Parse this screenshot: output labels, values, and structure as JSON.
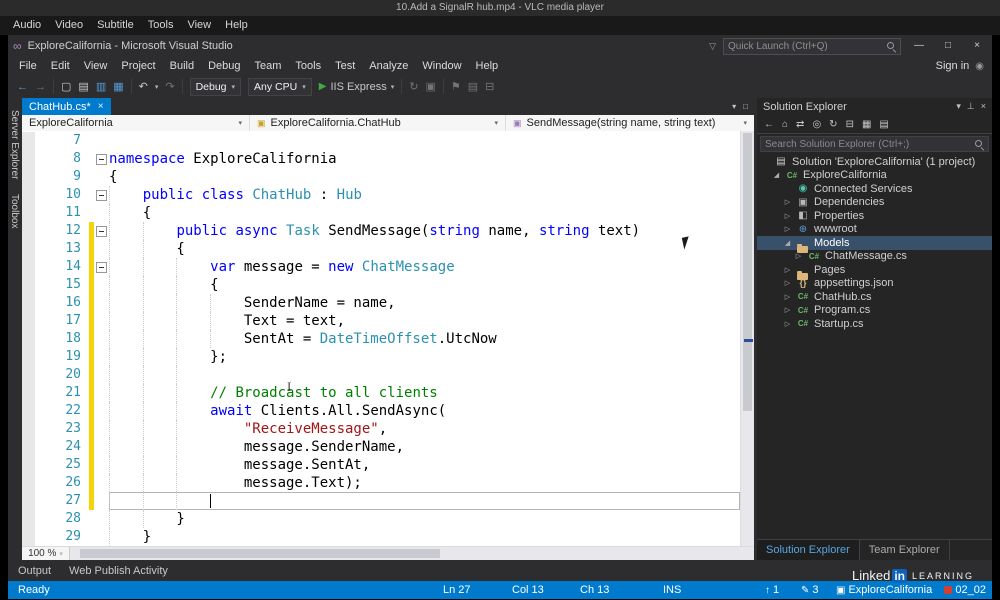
{
  "vlc": {
    "title": "10.Add a SignalR hub.mp4 - VLC media player",
    "menu": [
      "Audio",
      "Video",
      "Subtitle",
      "Tools",
      "View",
      "Help"
    ]
  },
  "vs": {
    "title": "ExploreCalifornia - Microsoft Visual Studio",
    "quick_launch_placeholder": "Quick Launch (Ctrl+Q)",
    "menu": [
      "File",
      "Edit",
      "View",
      "Project",
      "Build",
      "Debug",
      "Team",
      "Tools",
      "Test",
      "Analyze",
      "Window",
      "Help"
    ],
    "sign_in": "Sign in",
    "toolbar": {
      "debug_target": "Debug",
      "platform": "Any CPU",
      "run_label": "IIS Express"
    },
    "side_tabs": [
      "Server Explorer",
      "Toolbox"
    ],
    "doc_tab": {
      "label": "ChatHub.cs*"
    },
    "navbar": [
      "ExploreCalifornia",
      "ExploreCalifornia.ChatHub",
      "SendMessage(string name, string text)"
    ],
    "zoom": "100 %",
    "panel_tabs": [
      "Output",
      "Web Publish Activity"
    ],
    "status": {
      "ready": "Ready",
      "ln": "Ln 27",
      "col": "Col 13",
      "ch": "Ch 13",
      "ins": "INS",
      "push": "1",
      "edits": "3",
      "repo": "ExploreCalifornia",
      "chapter": "02_02"
    }
  },
  "editor": {
    "lines": [
      {
        "n": 7,
        "tokens": [],
        "guides": []
      },
      {
        "n": 8,
        "fold": true,
        "tokens": [
          [
            "k",
            "namespace"
          ],
          [
            "p",
            " ExploreCalifornia"
          ]
        ],
        "guides": []
      },
      {
        "n": 9,
        "tokens": [
          [
            "p",
            "{"
          ]
        ],
        "guides": []
      },
      {
        "n": 10,
        "fold": true,
        "tokens": [
          [
            "p",
            "    "
          ],
          [
            "k",
            "public"
          ],
          [
            "p",
            " "
          ],
          [
            "k",
            "class"
          ],
          [
            "p",
            " "
          ],
          [
            "t",
            "ChatHub"
          ],
          [
            "p",
            " : "
          ],
          [
            "t",
            "Hub"
          ]
        ],
        "guides": [
          0
        ]
      },
      {
        "n": 11,
        "tokens": [
          [
            "p",
            "    {"
          ]
        ],
        "guides": [
          0
        ]
      },
      {
        "n": 12,
        "fold": true,
        "changed": true,
        "tokens": [
          [
            "p",
            "        "
          ],
          [
            "k",
            "public"
          ],
          [
            "p",
            " "
          ],
          [
            "k",
            "async"
          ],
          [
            "p",
            " "
          ],
          [
            "t",
            "Task"
          ],
          [
            "p",
            " SendMessage("
          ],
          [
            "k",
            "string"
          ],
          [
            "p",
            " name, "
          ],
          [
            "k",
            "string"
          ],
          [
            "p",
            " text)"
          ]
        ],
        "guides": [
          0,
          4
        ]
      },
      {
        "n": 13,
        "changed": true,
        "tokens": [
          [
            "p",
            "        {"
          ]
        ],
        "guides": [
          0,
          4
        ]
      },
      {
        "n": 14,
        "fold": true,
        "changed": true,
        "tokens": [
          [
            "p",
            "            "
          ],
          [
            "k",
            "var"
          ],
          [
            "p",
            " message = "
          ],
          [
            "k",
            "new"
          ],
          [
            "p",
            " "
          ],
          [
            "t",
            "ChatMessage"
          ]
        ],
        "guides": [
          0,
          4,
          8
        ]
      },
      {
        "n": 15,
        "changed": true,
        "tokens": [
          [
            "p",
            "            {"
          ]
        ],
        "guides": [
          0,
          4,
          8
        ]
      },
      {
        "n": 16,
        "changed": true,
        "tokens": [
          [
            "p",
            "                SenderName = name,"
          ]
        ],
        "guides": [
          0,
          4,
          8,
          12
        ]
      },
      {
        "n": 17,
        "changed": true,
        "tokens": [
          [
            "p",
            "                Text = text,"
          ]
        ],
        "guides": [
          0,
          4,
          8,
          12
        ]
      },
      {
        "n": 18,
        "changed": true,
        "tokens": [
          [
            "p",
            "                SentAt = "
          ],
          [
            "t",
            "DateTimeOffset"
          ],
          [
            "p",
            ".UtcNow"
          ]
        ],
        "guides": [
          0,
          4,
          8,
          12
        ]
      },
      {
        "n": 19,
        "changed": true,
        "tokens": [
          [
            "p",
            "            };"
          ]
        ],
        "guides": [
          0,
          4,
          8
        ]
      },
      {
        "n": 20,
        "changed": true,
        "tokens": [],
        "guides": [
          0,
          4,
          8
        ]
      },
      {
        "n": 21,
        "changed": true,
        "tokens": [
          [
            "p",
            "            "
          ],
          [
            "c",
            "// Broadcast to all clients"
          ]
        ],
        "guides": [
          0,
          4,
          8
        ]
      },
      {
        "n": 22,
        "changed": true,
        "tokens": [
          [
            "p",
            "            "
          ],
          [
            "k",
            "await"
          ],
          [
            "p",
            " Clients.All.SendAsync("
          ]
        ],
        "guides": [
          0,
          4,
          8
        ]
      },
      {
        "n": 23,
        "changed": true,
        "tokens": [
          [
            "p",
            "                "
          ],
          [
            "s",
            "\"ReceiveMessage\""
          ],
          [
            "p",
            ","
          ]
        ],
        "guides": [
          0,
          4,
          8
        ]
      },
      {
        "n": 24,
        "changed": true,
        "tokens": [
          [
            "p",
            "                message.SenderName,"
          ]
        ],
        "guides": [
          0,
          4,
          8
        ]
      },
      {
        "n": 25,
        "changed": true,
        "tokens": [
          [
            "p",
            "                message.SentAt,"
          ]
        ],
        "guides": [
          0,
          4,
          8
        ]
      },
      {
        "n": 26,
        "changed": true,
        "tokens": [
          [
            "p",
            "                message.Text);"
          ]
        ],
        "guides": [
          0,
          4,
          8
        ]
      },
      {
        "n": 27,
        "changed": true,
        "current": true,
        "tokens": [],
        "guides": [
          0,
          4,
          8
        ]
      },
      {
        "n": 28,
        "tokens": [
          [
            "p",
            "        }"
          ]
        ],
        "guides": [
          0,
          4
        ]
      },
      {
        "n": 29,
        "tokens": [
          [
            "p",
            "    }"
          ]
        ],
        "guides": [
          0
        ]
      }
    ]
  },
  "solution_explorer": {
    "title": "Solution Explorer",
    "search_placeholder": "Search Solution Explorer (Ctrl+;)",
    "icon_glyphs": {
      "solution": "▤",
      "csproj": "C#",
      "services": "◉",
      "deps": "▣",
      "props": "◧",
      "globe": "⊕",
      "folder": "",
      "cs": "C#",
      "json": "{}"
    },
    "tree": [
      {
        "label": "Solution 'ExploreCalifornia' (1 project)",
        "depth": 0,
        "icon": "solution"
      },
      {
        "label": "ExploreCalifornia",
        "depth": 1,
        "icon": "csproj",
        "exp": "expanded"
      },
      {
        "label": "Connected Services",
        "depth": 2,
        "icon": "services"
      },
      {
        "label": "Dependencies",
        "depth": 2,
        "icon": "deps",
        "exp": "collapsed"
      },
      {
        "label": "Properties",
        "depth": 2,
        "icon": "props",
        "exp": "collapsed"
      },
      {
        "label": "wwwroot",
        "depth": 2,
        "icon": "globe",
        "exp": "collapsed"
      },
      {
        "label": "Models",
        "depth": 2,
        "icon": "folder",
        "exp": "expanded",
        "selected": true
      },
      {
        "label": "ChatMessage.cs",
        "depth": 3,
        "icon": "cs",
        "exp": "collapsed"
      },
      {
        "label": "Pages",
        "depth": 2,
        "icon": "folder",
        "exp": "collapsed"
      },
      {
        "label": "appsettings.json",
        "depth": 2,
        "icon": "json",
        "exp": "collapsed"
      },
      {
        "label": "ChatHub.cs",
        "depth": 2,
        "icon": "cs",
        "exp": "collapsed"
      },
      {
        "label": "Program.cs",
        "depth": 2,
        "icon": "cs",
        "exp": "collapsed"
      },
      {
        "label": "Startup.cs",
        "depth": 2,
        "icon": "cs",
        "exp": "collapsed"
      }
    ],
    "bottom_tabs": [
      "Solution Explorer",
      "Team Explorer"
    ]
  },
  "watermark": {
    "linked": "Linked",
    "in": "in",
    "learning": "LEARNING"
  },
  "icons": {
    "caret_down": "▾",
    "close": "×",
    "minimize": "—",
    "maximize": "□",
    "back": "←",
    "forward": "→",
    "new_project": "▢",
    "open": "▤",
    "save": "▥",
    "save_all": "▦",
    "undo": "↶",
    "redo": "↷",
    "play": "▶",
    "sync": "↻",
    "build": "▣",
    "bookmark": "⚑",
    "funnel": "▽",
    "home": "⌂",
    "switch": "⇄",
    "scope": "◎",
    "refresh": "↻",
    "collapse": "⊟",
    "properties": "▦",
    "preview": "▤",
    "pin": "⊥",
    "up_arrow": "↑",
    "pencil": "✎",
    "repo": "▣",
    "expanded": "◢",
    "collapsed": "▷",
    "person": "◉"
  }
}
